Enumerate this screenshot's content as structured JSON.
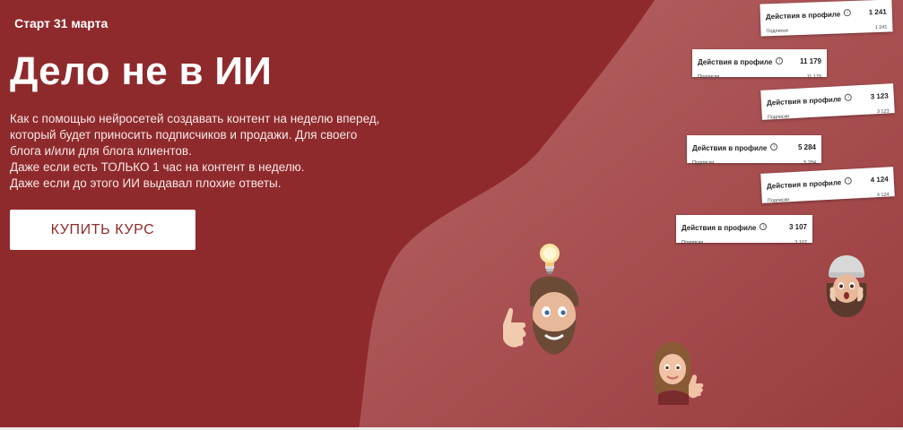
{
  "hero": {
    "start_label": "Старт 31 марта",
    "title": "Дело не в ИИ",
    "description": "Как с помощью нейросетей создавать контент на неделю вперед, который будет приносить подписчиков и продажи. Для своего блога и/или для блога клиентов.",
    "note_line1": "Даже если есть ТОЛЬКО 1 час на контент в неделю.",
    "note_line2": "Даже если до этого ИИ выдавал плохие ответы.",
    "buy_button": "КУПИТЬ КУРС"
  },
  "stat_cards": [
    {
      "title": "Действия в профиле",
      "value": "1 241",
      "sub_label": "Подписки",
      "sub_value": "1 241"
    },
    {
      "title": "Действия в профиле",
      "value": "11 179",
      "sub_label": "Подписки",
      "sub_value": "11 179"
    },
    {
      "title": "Действия в профиле",
      "value": "3 123",
      "sub_label": "Подписки",
      "sub_value": "3 123"
    },
    {
      "title": "Действия в профиле",
      "value": "5 284",
      "sub_label": "Подписки",
      "sub_value": "5 284"
    },
    {
      "title": "Действия в профиле",
      "value": "4 124",
      "sub_label": "Подписки",
      "sub_value": "4 124"
    },
    {
      "title": "Действия в профиле",
      "value": "3 107",
      "sub_label": "Подписки",
      "sub_value": "3 107"
    }
  ],
  "colors": {
    "background": "#8f2a2c",
    "wave": "#a84e50",
    "button_text": "#8f2a2c"
  }
}
